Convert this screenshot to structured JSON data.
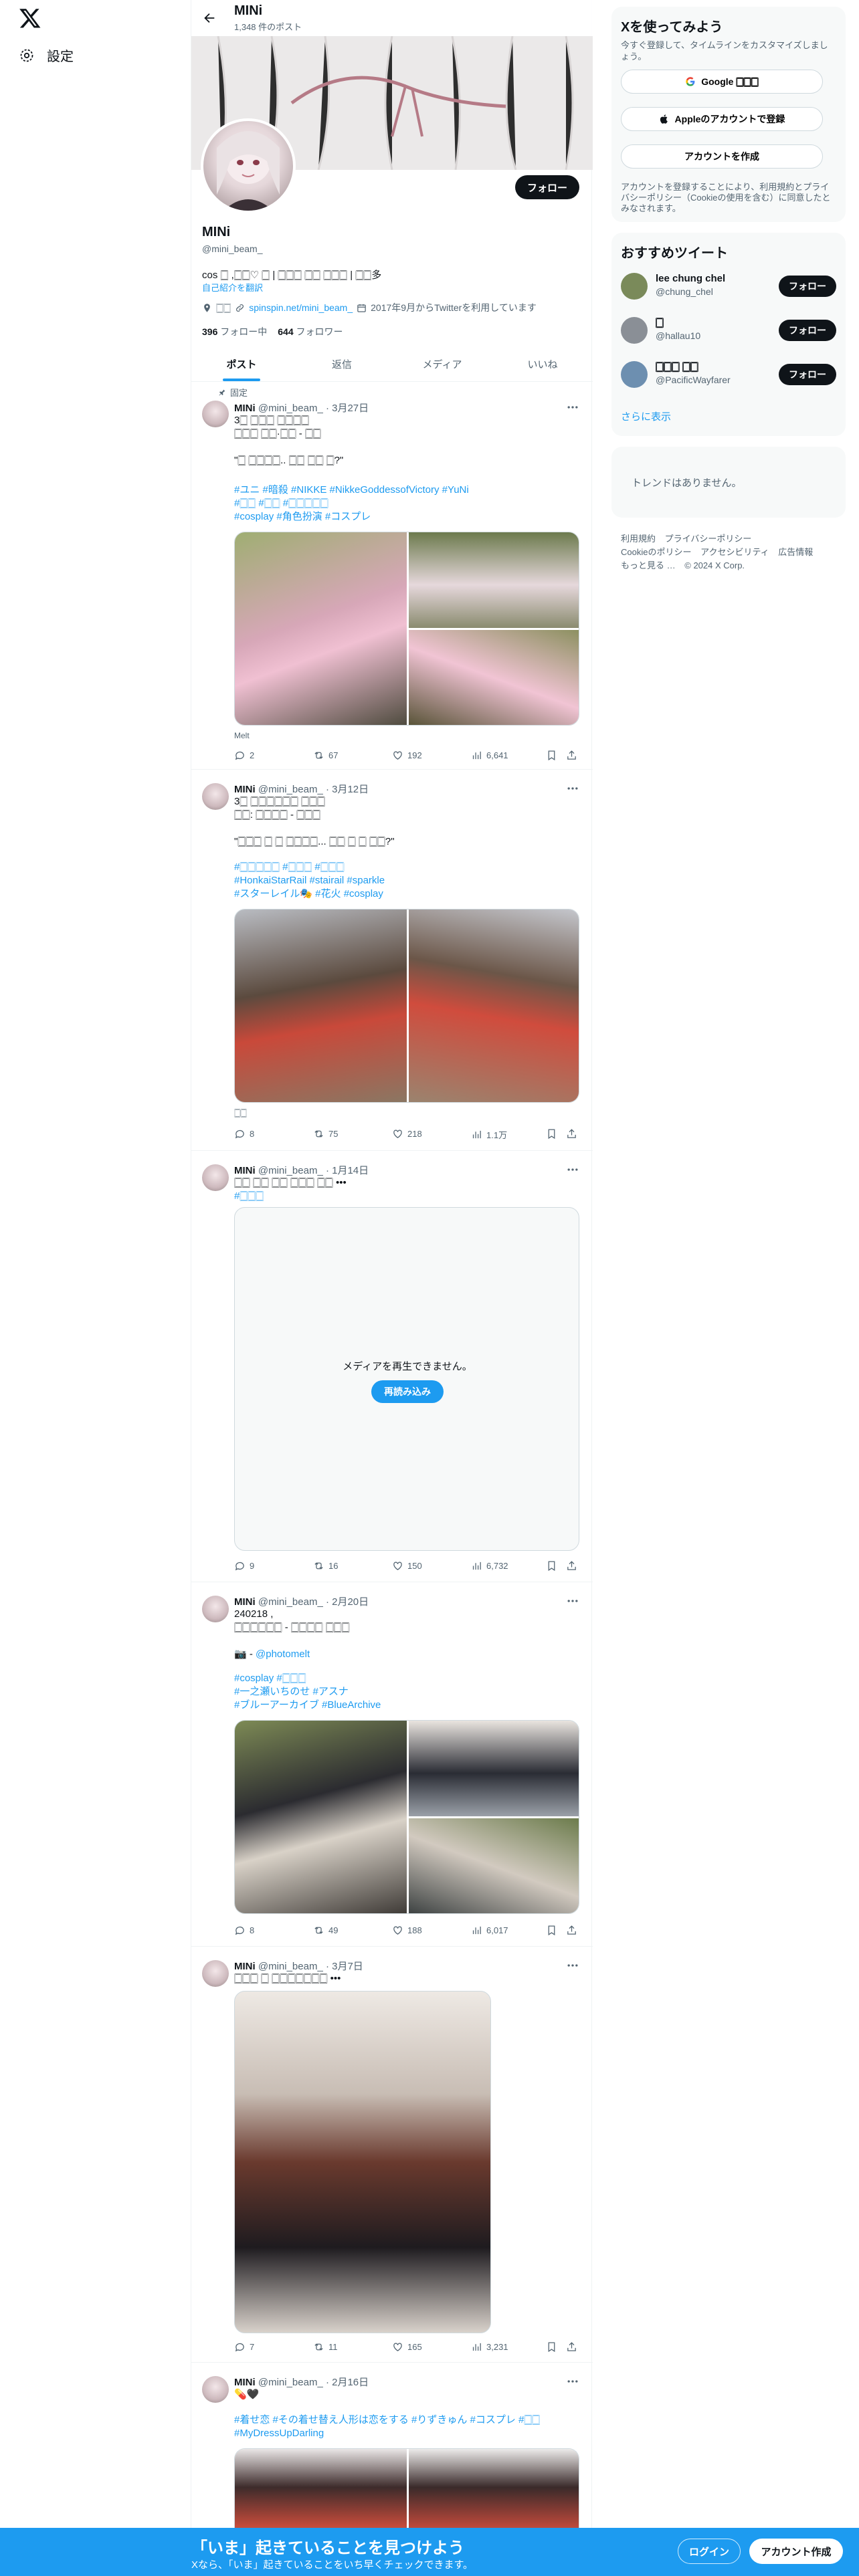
{
  "colors": {
    "accent": "#1d9bf0",
    "text": "#0f1419",
    "muted": "#536471"
  },
  "nav": {
    "settings_label": "設定"
  },
  "header": {
    "name": "MINi",
    "post_count": "1,348 件のポスト"
  },
  "profile": {
    "name": "MINi",
    "handle": "@mini_beam_",
    "follow_label": "フォロー",
    "bio": "cos 🀆 ,🀆🀆♡ 🀆 | 🀆🀆🀆 🀆🀆 🀆🀆🀆 | 🀆🀆多",
    "translate_label": "自己紹介を翻訳",
    "location": "🀆🀆",
    "website": "spinspin.net/mini_beam_",
    "joined": "2017年9月からTwitterを利用しています",
    "following_count": "396",
    "following_label": "フォロー中",
    "followers_count": "644",
    "followers_label": "フォロワー"
  },
  "tabs": [
    "ポスト",
    "返信",
    "メディア",
    "いいね"
  ],
  "pinned_label": "固定",
  "tweets": [
    {
      "name": "MINi",
      "handle": "@mini_beam_",
      "date": "3月27日",
      "text": "3🀆 🀆🀆🀆 🀆🀆🀆🀆\n🀆🀆🀆 🀆🀆·🀆🀆 - 🀆🀆\n\n\"🀆 🀆🀆🀆🀆.. 🀆🀆 🀆🀆 🀆?\"",
      "tags": "#ユニ #暗殺 #NIKKE #NikkeGoddessofVictory #YuNi\n#🀆🀆 #🀆🀆 #🀆🀆🀆🀆🀆\n#cosplay #角色扮演 #コスプレ",
      "caption": "Melt",
      "replies": "2",
      "reposts": "67",
      "likes": "192",
      "views": "6,641"
    },
    {
      "name": "MINi",
      "handle": "@mini_beam_",
      "date": "3月12日",
      "text": "3🀆 🀆🀆🀆🀆🀆🀆 🀆🀆🀆\n🀆🀆: 🀆🀆🀆🀆 - 🀆🀆🀆\n\n\"🀆🀆🀆 🀆 🀆 🀆🀆🀆🀆... 🀆🀆 🀆 🀆 🀆🀆?\"",
      "tags": "#🀆🀆🀆🀆🀆 #🀆🀆🀆 #🀆🀆🀆\n#HonkaiStarRail #stairail #sparkle\n#スターレイル🎭 #花火 #cosplay",
      "caption": "🀆🀆",
      "replies": "8",
      "reposts": "75",
      "likes": "218",
      "views": "1.1万"
    },
    {
      "name": "MINi",
      "handle": "@mini_beam_",
      "date": "1月14日",
      "text": "🀆🀆 🀆🀆 🀆🀆 🀆🀆🀆 🀆🀆 •••",
      "tags": "#🀆🀆🀆",
      "video_error": "メディアを再生できません。",
      "video_reload": "再読み込み",
      "replies": "9",
      "reposts": "16",
      "likes": "150",
      "views": "6,732"
    },
    {
      "name": "MINi",
      "handle": "@mini_beam_",
      "date": "2月20日",
      "text": "240218 ,\n🀆🀆🀆🀆🀆🀆 - 🀆🀆🀆🀆 🀆🀆🀆\n\n📷 - ",
      "mention": "@photomelt",
      "tags": "#cosplay #🀆🀆🀆\n#一之瀬いちのせ #アスナ\n#ブルーアーカイブ #BlueArchive",
      "replies": "8",
      "reposts": "49",
      "likes": "188",
      "views": "6,017"
    },
    {
      "name": "MINi",
      "handle": "@mini_beam_",
      "date": "3月7日",
      "text": "🀆🀆🀆 🀆 🀆🀆🀆🀆🀆🀆🀆 •••",
      "replies": "7",
      "reposts": "11",
      "likes": "165",
      "views": "3,231"
    },
    {
      "name": "MINi",
      "handle": "@mini_beam_",
      "date": "2月16日",
      "text": "💊🖤",
      "tags": "#着せ恋 #その着せ替え人形は恋をする #りずきゅん #コスプレ #🀆🀆\n#MyDressUpDarling"
    }
  ],
  "right": {
    "join_title": "Xを使ってみよう",
    "join_sub": "今すぐ登録して、タイムラインをカスタマイズしましょう。",
    "google_label": "Google 🀆🀆🀆",
    "apple_label": "Appleのアカウントで登録",
    "create_label": "アカウントを作成",
    "terms_text": "アカウントを登録することにより、利用規約とプライバシーポリシー（Cookieの使用を含む）に同意したとみなされます。",
    "who_title": "おすすめツイート",
    "who": [
      {
        "name": "lee chung chel",
        "handle": "@chung_chel",
        "follow": "フォロー",
        "color": "#7a8a5a"
      },
      {
        "name": "🀆",
        "handle": "@hallau10",
        "follow": "フォロー",
        "color": "#8a8f96"
      },
      {
        "name": "🀆🀆🀆 🀆🀆",
        "handle": "@PacificWayfarer",
        "follow": "フォロー",
        "color": "#6d8fb0"
      }
    ],
    "who_more": "さらに表示",
    "trends_empty": "トレンドはありません。",
    "footer": [
      "利用規約",
      "プライバシーポリシー",
      "Cookieのポリシー",
      "アクセシビリティ",
      "広告情報",
      "もっと見る …",
      "© 2024 X Corp."
    ]
  },
  "bottom_bar": {
    "title": "「いま」起きていることを見つけよう",
    "subtitle": "Xなら、「いま」起きていることをいち早くチェックできます。",
    "login": "ログイン",
    "signup": "アカウント作成"
  }
}
